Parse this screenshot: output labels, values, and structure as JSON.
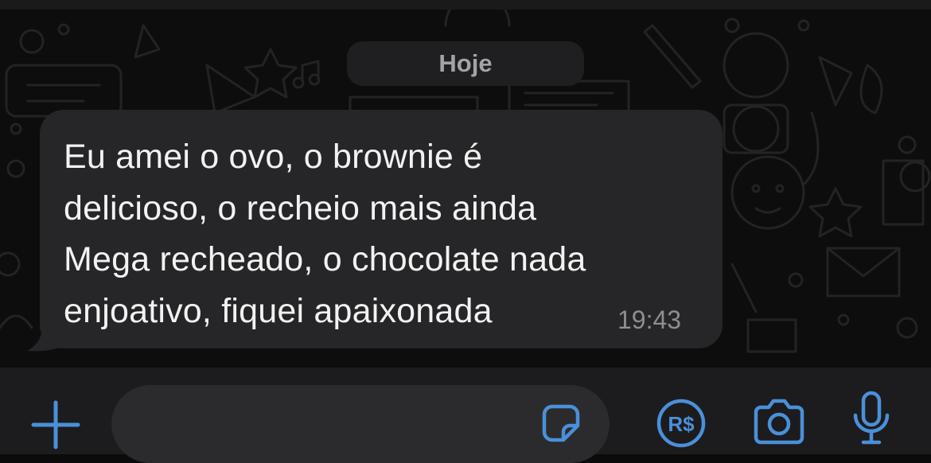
{
  "chat": {
    "date_label": "Hoje",
    "message": {
      "text": "Eu amei o ovo, o brownie é\ndelicioso, o recheio mais ainda\nMega recheado, o chocolate nada\nenjoativo, fiquei apaixonada",
      "time": "19:43",
      "direction": "incoming"
    }
  },
  "composer": {
    "input_value": "",
    "input_placeholder": "",
    "buttons": {
      "attach_icon": "plus-icon",
      "sticker_icon": "sticker-icon",
      "payment_icon": "payment-icon",
      "payment_label": "R$",
      "camera_icon": "camera-icon",
      "mic_icon": "microphone-icon"
    }
  },
  "colors": {
    "background": "#0b0b0b",
    "bubble": "#262628",
    "accent": "#4a90d9",
    "input_bar": "#1c1c1e"
  }
}
